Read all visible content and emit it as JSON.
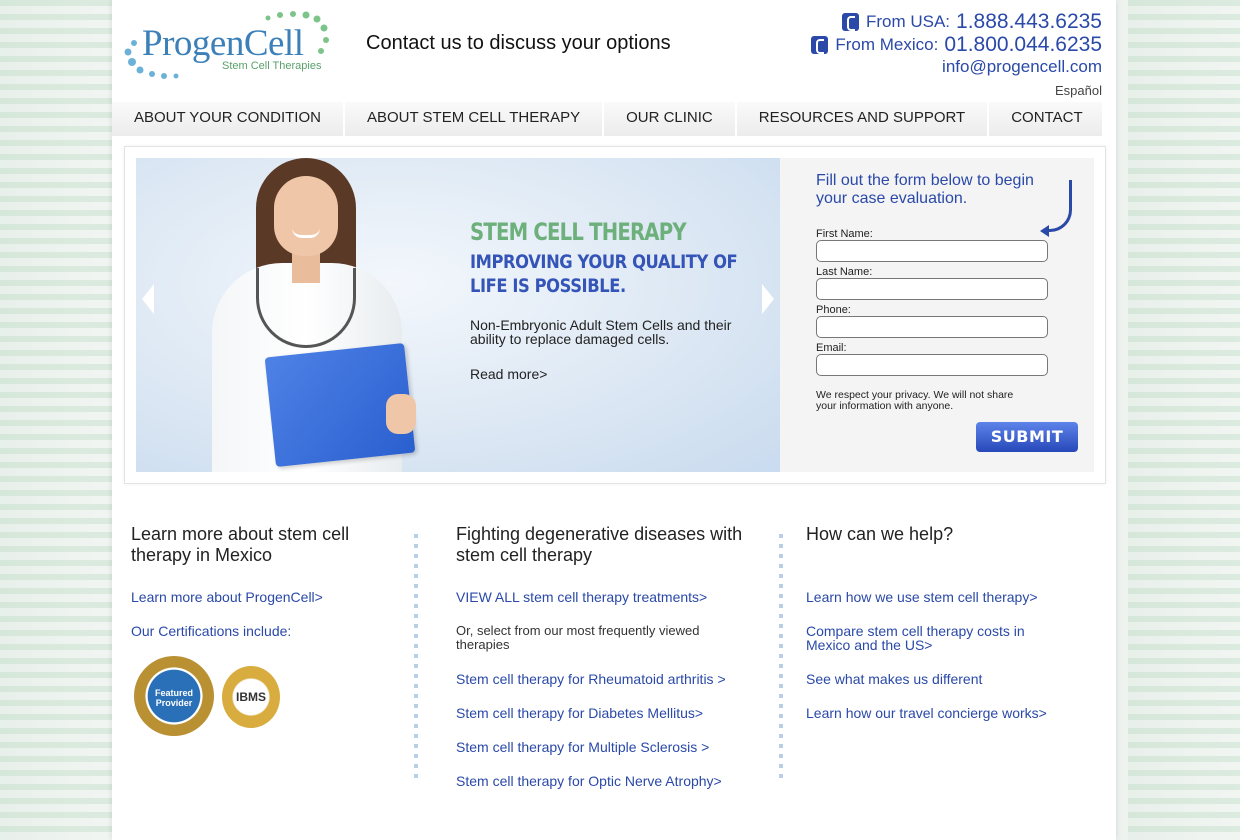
{
  "header": {
    "logo_text": "ProgenCell",
    "logo_tagline": "Stem Cell Therapies",
    "contact_tagline": "Contact us to discuss your options",
    "phones": [
      {
        "label": "From USA:",
        "number": "1.888.443.6235"
      },
      {
        "label": "From Mexico:",
        "number": "01.800.044.6235"
      }
    ],
    "email": "info@progencell.com",
    "language_link": "Español"
  },
  "nav": {
    "items": [
      "ABOUT YOUR CONDITION",
      "ABOUT STEM CELL THERAPY",
      "OUR CLINIC",
      "RESOURCES AND SUPPORT",
      "CONTACT"
    ]
  },
  "hero": {
    "title": "STEM CELL THERAPY",
    "subtitle": "IMPROVING YOUR QUALITY OF LIFE IS POSSIBLE.",
    "description": "Non-Embryonic Adult Stem Cells and their ability to replace damaged cells.",
    "read_more": "Read more>"
  },
  "form": {
    "intro": "Fill out the form below to begin your case evaluation.",
    "fields": [
      {
        "label": "First Name:",
        "value": ""
      },
      {
        "label": "Last Name:",
        "value": ""
      },
      {
        "label": "Phone:",
        "value": ""
      },
      {
        "label": "Email:",
        "value": ""
      }
    ],
    "privacy": "We respect your privacy. We will not share your information with anyone.",
    "submit_label": "SUBMIT"
  },
  "columns": {
    "col1": {
      "heading": "Learn more about stem cell therapy in Mexico",
      "link1": "Learn more about ProgenCell>",
      "link2": "Our Certifications include:",
      "badge1": "Featured Provider",
      "badge2": "IBMS"
    },
    "col2": {
      "heading": "Fighting degenerative diseases with stem cell therapy",
      "view_all": "VIEW ALL stem cell therapy treatments>",
      "or_text": "Or, select from our most frequently viewed therapies",
      "links": [
        "Stem cell therapy for Rheumatoid arthritis >",
        "Stem cell therapy for Diabetes Mellitus>",
        "Stem cell therapy for Multiple Sclerosis >",
        "Stem cell therapy for Optic Nerve Atrophy>"
      ]
    },
    "col3": {
      "heading": "How can we help?",
      "links": [
        "Learn how we use stem cell therapy>",
        "Compare stem cell therapy costs in Mexico and the US>",
        "See what makes us different",
        "Learn how our travel concierge works>"
      ]
    }
  }
}
